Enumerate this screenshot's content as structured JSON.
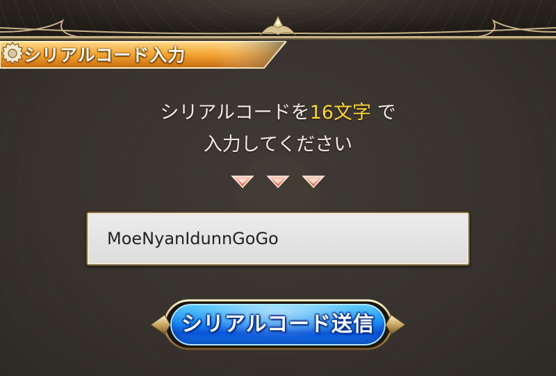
{
  "header": {
    "title": "シリアルコード入力",
    "icon": "gear-icon"
  },
  "instruction": {
    "line1_before": "シリアルコードを",
    "line1_highlight": "16文字",
    "line1_after": " で",
    "line2": "入力してください",
    "highlight_color": "#ffd53a"
  },
  "serial_input": {
    "value": "MoeNyanIdunnGoGo"
  },
  "submit": {
    "label": "シリアルコード送信"
  },
  "colors": {
    "panel": "#3b3631",
    "gold_frame": "#c9b489",
    "tab_orange": "#f0a42a",
    "button_blue": "#1e8cf0"
  }
}
